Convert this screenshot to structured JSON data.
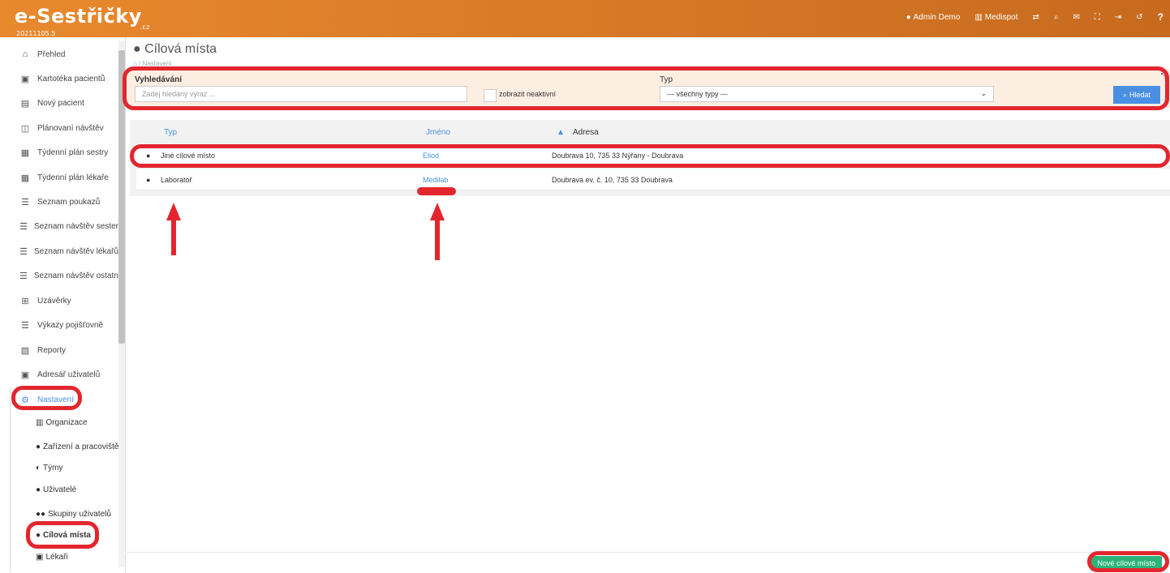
{
  "app": {
    "logo": "e-Sestřičky",
    "logo_tld": ".cz",
    "version": "20211105.5"
  },
  "topnav": {
    "user": "Admin Demo",
    "org": "Medispot",
    "icons": [
      "swap-icon",
      "search-icon",
      "mail-icon",
      "fullscreen-icon",
      "logout-icon",
      "history-icon",
      "help-icon"
    ],
    "help_glyph": "?"
  },
  "sidebar": {
    "items": [
      {
        "label": "Přehled",
        "glyph": "⌂"
      },
      {
        "label": "Kartotéka pacientů",
        "glyph": "▣"
      },
      {
        "label": "Nový pacient",
        "glyph": "▤"
      },
      {
        "label": "Plánovaní návštěv",
        "glyph": "◫"
      },
      {
        "label": "Týdenní plán sestry",
        "glyph": "▦"
      },
      {
        "label": "Týdenní plán lékaře",
        "glyph": "▦"
      },
      {
        "label": "Seznam poukazů",
        "glyph": "☰"
      },
      {
        "label": "Seznam návštěv sester",
        "glyph": "☰"
      },
      {
        "label": "Seznam návštěv lékařů",
        "glyph": "☰"
      },
      {
        "label": "Seznam návštěv ostatní",
        "glyph": "☰"
      },
      {
        "label": "Uzávěrky",
        "glyph": "⊞"
      },
      {
        "label": "Výkazy pojišťovně",
        "glyph": "☰"
      },
      {
        "label": "Reporty",
        "glyph": "▨"
      },
      {
        "label": "Adresář uživatelů",
        "glyph": "▣"
      },
      {
        "label": "Nastavení",
        "glyph": "⚙"
      }
    ],
    "subitems": [
      {
        "label": "Organizace",
        "glyph": "▥"
      },
      {
        "label": "Zařízení a pracoviště",
        "glyph": "●"
      },
      {
        "label": "Týmy",
        "glyph": "◐"
      },
      {
        "label": "Uživatelé",
        "glyph": "●"
      },
      {
        "label": "Skupiny uživatelů",
        "glyph": "●●"
      },
      {
        "label": "Cílová místa",
        "glyph": "●"
      },
      {
        "label": "Lékaři",
        "glyph": "▣"
      }
    ]
  },
  "page": {
    "title": "Cílová místa",
    "breadcrumb_sep": "/",
    "breadcrumb": "Nastavení"
  },
  "filter": {
    "search_label": "Vyhledávání",
    "search_placeholder": "Zadej hledaný výraz ...",
    "inactive_label": "zobrazit neaktivní",
    "type_label": "Typ",
    "type_value": "--- všechny typy ---",
    "search_button": "Hledat"
  },
  "table": {
    "columns": [
      "Typ",
      "Jméno",
      "Adresa"
    ],
    "sort_indicator": "▲",
    "rows": [
      {
        "typ": "Jiné cílové místo",
        "jmeno": "Eliod",
        "adresa": "Doubrava 10, 735 33 Nýřany - Doubrava"
      },
      {
        "typ": "Laboratoř",
        "jmeno": "Medilab",
        "adresa": "Doubrava ev. č. 10, 735 33 Doubrava"
      }
    ]
  },
  "footer": {
    "new_button": "Nové cílové místo"
  },
  "colors": {
    "header": "#e8892e",
    "annotation": "#e3262e",
    "primary": "#4a90e2",
    "success": "#2bb37a",
    "filter_bg": "#fdeee2"
  }
}
